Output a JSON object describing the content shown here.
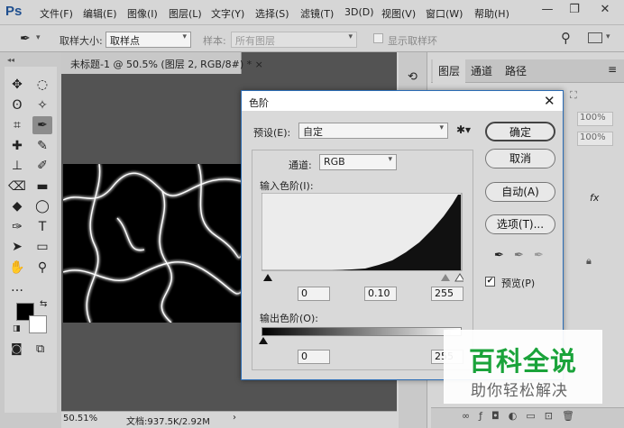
{
  "app": {
    "logo": "Ps"
  },
  "menu": [
    "文件(F)",
    "编辑(E)",
    "图像(I)",
    "图层(L)",
    "文字(Y)",
    "选择(S)",
    "滤镜(T)",
    "3D(D)",
    "视图(V)",
    "窗口(W)",
    "帮助(H)"
  ],
  "window_controls": {
    "minimize": "—",
    "restore": "❐",
    "close": "✕"
  },
  "options_bar": {
    "sample_size_label": "取样大小:",
    "sample_size_value": "取样点",
    "sample_label": "样本:",
    "sample_value": "所有图层",
    "show_ring_label": "显示取样环"
  },
  "document": {
    "tab_title": "未标题-1 @ 50.5% (图层 2, RGB/8#) *",
    "tab_close": "×",
    "zoom": "50.51%",
    "doc_info": "文档:937.5K/2.92M"
  },
  "panels": {
    "tabs": [
      "图层",
      "通道",
      "路径"
    ],
    "opacity": "100%",
    "fill": "100%",
    "fx": "fx"
  },
  "dialog": {
    "title": "色阶",
    "close": "✕",
    "preset_label": "预设(E):",
    "preset_value": "自定",
    "channel_label": "通道:",
    "channel_value": "RGB",
    "input_levels_label": "输入色阶(I):",
    "input_black": "0",
    "input_gamma": "0.10",
    "input_white": "255",
    "output_levels_label": "输出色阶(O):",
    "output_black": "0",
    "output_white": "255",
    "buttons": {
      "ok": "确定",
      "cancel": "取消",
      "auto": "自动(A)",
      "options": "选项(T)..."
    },
    "preview_label": "预览(P)",
    "preview_checked": true
  },
  "watermark": {
    "title": "百科全说",
    "subtitle": "助你轻松解决"
  },
  "colors": {
    "accent_title": "#2b6cb5",
    "watermark_green": "#1aa33a"
  }
}
